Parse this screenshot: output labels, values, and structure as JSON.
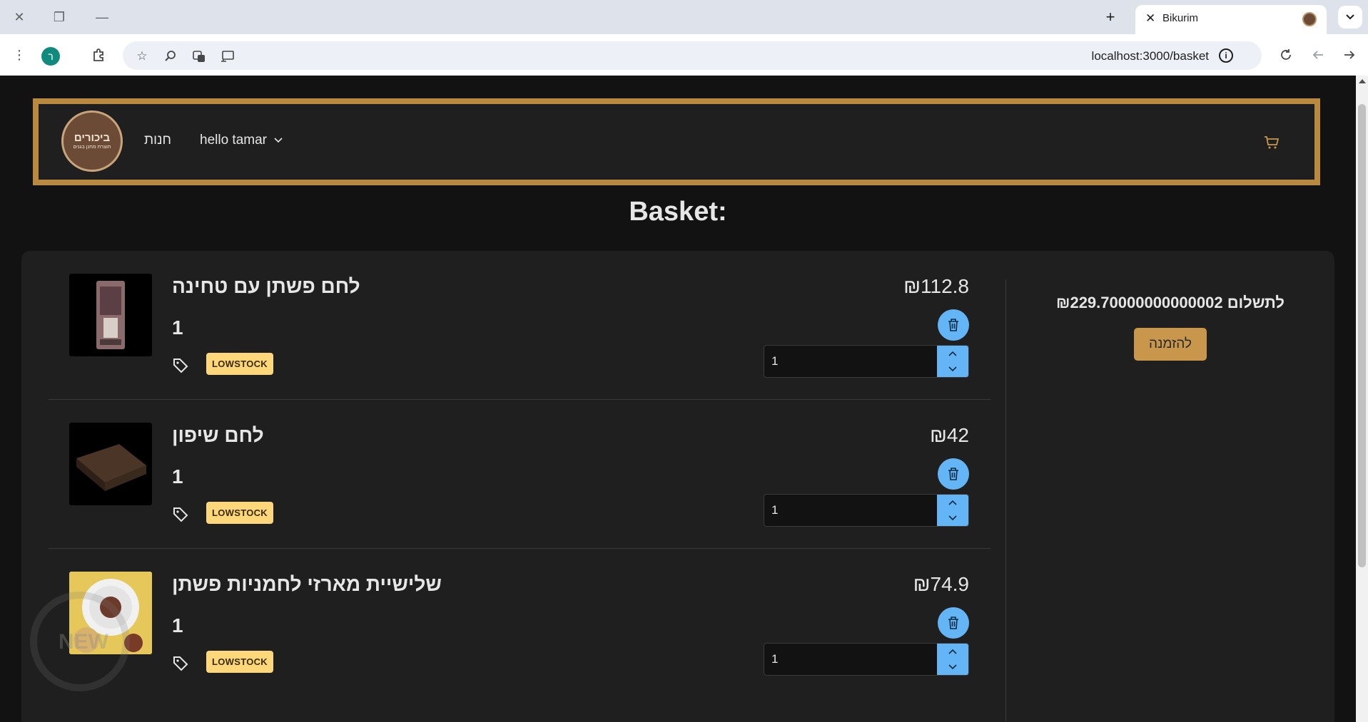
{
  "browser": {
    "tab_title": "Bikurim",
    "url": "localhost:3000/basket",
    "profile_initial": "ר"
  },
  "nav": {
    "logo_line1": "ביכורים",
    "logo_line2": "תוצרת מחנן בגנים",
    "shop_link": "חנות",
    "user_menu": "hello tamar"
  },
  "page_title": "Basket:",
  "summary": {
    "total_label": "לתשלום ₪229.70000000000002",
    "order_button": "להזמנה"
  },
  "items": [
    {
      "name": "לחם פשתן עם טחינה",
      "quantity_text": "1",
      "status": "LOWSTOCK",
      "price": "₪112.8",
      "quantity_input": "1"
    },
    {
      "name": "לחם שיפון",
      "quantity_text": "1",
      "status": "LOWSTOCK",
      "price": "₪42",
      "quantity_input": "1"
    },
    {
      "name": "שלישיית מארזי לחמניות פשתן",
      "quantity_text": "1",
      "status": "LOWSTOCK",
      "price": "₪74.9",
      "quantity_input": "1"
    }
  ],
  "watermark_text": "NEW",
  "colors": {
    "accent_gold": "#b8893f",
    "order_button": "#c8974c",
    "action_blue": "#64b5f6",
    "badge_yellow": "#fdd77a",
    "panel": "#1f1f1f",
    "background": "#121212"
  },
  "icons": [
    "close-icon",
    "restore-icon",
    "minimize-icon",
    "new-tab-icon",
    "tab-menu-icon",
    "menu-dots-icon",
    "extensions-icon",
    "bookmark-star-icon",
    "zoom-icon",
    "translate-icon",
    "cast-icon",
    "site-info-icon",
    "reload-icon",
    "back-icon",
    "forward-icon",
    "cart-icon",
    "trash-icon",
    "tag-icon",
    "chevron-up-icon",
    "chevron-down-icon"
  ]
}
